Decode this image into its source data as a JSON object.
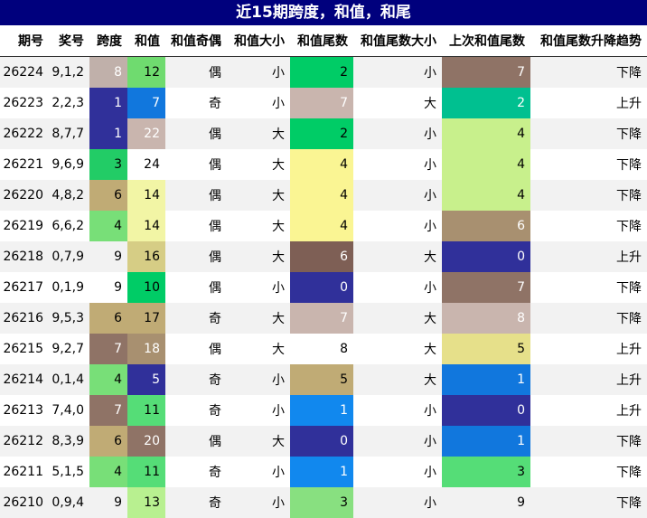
{
  "chart_data": {
    "type": "table",
    "title": "近15期跨度，和值，和尾",
    "columns": [
      "期号",
      "奖号",
      "跨度",
      "和值",
      "和值奇偶",
      "和值大小",
      "和值尾数",
      "和值尾数大小",
      "上次和值尾数",
      "和值尾数升降趋势"
    ],
    "rows": [
      [
        "26224",
        "9,1,2",
        "8",
        "12",
        "偶",
        "小",
        "2",
        "小",
        "7",
        "下降"
      ],
      [
        "26223",
        "2,2,3",
        "1",
        "7",
        "奇",
        "小",
        "7",
        "大",
        "2",
        "上升"
      ],
      [
        "26222",
        "8,7,7",
        "1",
        "22",
        "偶",
        "大",
        "2",
        "小",
        "4",
        "下降"
      ],
      [
        "26221",
        "9,6,9",
        "3",
        "24",
        "偶",
        "大",
        "4",
        "小",
        "4",
        "下降"
      ],
      [
        "26220",
        "4,8,2",
        "6",
        "14",
        "偶",
        "大",
        "4",
        "小",
        "4",
        "下降"
      ],
      [
        "26219",
        "6,6,2",
        "4",
        "14",
        "偶",
        "大",
        "4",
        "小",
        "6",
        "下降"
      ],
      [
        "26218",
        "0,7,9",
        "9",
        "16",
        "偶",
        "大",
        "6",
        "大",
        "0",
        "上升"
      ],
      [
        "26217",
        "0,1,9",
        "9",
        "10",
        "偶",
        "小",
        "0",
        "小",
        "7",
        "下降"
      ],
      [
        "26216",
        "9,5,3",
        "6",
        "17",
        "奇",
        "大",
        "7",
        "大",
        "8",
        "下降"
      ],
      [
        "26215",
        "9,2,7",
        "7",
        "18",
        "偶",
        "大",
        "8",
        "大",
        "5",
        "上升"
      ],
      [
        "26214",
        "0,1,4",
        "4",
        "5",
        "奇",
        "小",
        "5",
        "大",
        "1",
        "上升"
      ],
      [
        "26213",
        "7,4,0",
        "7",
        "11",
        "奇",
        "小",
        "1",
        "小",
        "0",
        "上升"
      ],
      [
        "26212",
        "8,3,9",
        "6",
        "20",
        "偶",
        "大",
        "0",
        "小",
        "1",
        "下降"
      ],
      [
        "26211",
        "5,1,5",
        "4",
        "11",
        "奇",
        "小",
        "1",
        "小",
        "3",
        "下降"
      ],
      [
        "26210",
        "0,9,4",
        "9",
        "13",
        "奇",
        "小",
        "3",
        "小",
        "9",
        "下降"
      ]
    ],
    "cell_colors": [
      [
        null,
        null,
        "#c0b0aa",
        "#6fdb6f",
        null,
        null,
        "#00cc66",
        null,
        "#8f7366",
        null
      ],
      [
        null,
        null,
        "#30309a",
        "#1177dd",
        null,
        null,
        "#c9b5ae",
        null,
        "#00c090",
        null
      ],
      [
        null,
        null,
        "#30309a",
        "#c9b5ae",
        null,
        null,
        "#00cc66",
        null,
        "#c8f08c",
        null
      ],
      [
        null,
        null,
        "#22cc66",
        null,
        null,
        null,
        "#faf593",
        null,
        "#c8f08c",
        null
      ],
      [
        null,
        null,
        "#c0ab75",
        "#f2f5a5",
        null,
        null,
        "#faf593",
        null,
        "#c8f08c",
        null
      ],
      [
        null,
        null,
        "#78df78",
        "#f2f5a5",
        null,
        null,
        "#faf593",
        null,
        "#a89070",
        null
      ],
      [
        null,
        null,
        null,
        "#d6cd85",
        null,
        null,
        "#7e5f55",
        null,
        "#30309a",
        null
      ],
      [
        null,
        null,
        null,
        "#00cc66",
        null,
        null,
        "#30309a",
        null,
        "#8f7366",
        null
      ],
      [
        null,
        null,
        "#c0ab75",
        "#c0ab75",
        null,
        null,
        "#c9b5ae",
        null,
        "#c9b5ae",
        null
      ],
      [
        null,
        null,
        "#8f7366",
        "#a89070",
        null,
        null,
        null,
        null,
        "#e6e08a",
        null
      ],
      [
        null,
        null,
        "#78df78",
        "#30309a",
        null,
        null,
        "#c0ab75",
        null,
        "#1177dd",
        null
      ],
      [
        null,
        null,
        "#8f7366",
        "#55dd77",
        null,
        null,
        "#1188ee",
        null,
        "#30309a",
        null
      ],
      [
        null,
        null,
        "#c0ab75",
        "#8f7366",
        null,
        null,
        "#30309a",
        null,
        "#1177dd",
        null
      ],
      [
        null,
        null,
        "#78df78",
        "#55dd77",
        null,
        null,
        "#1188ee",
        null,
        "#55dd77",
        null
      ],
      [
        null,
        null,
        null,
        "#b8f090",
        null,
        null,
        "#88e080",
        null,
        null,
        null
      ]
    ],
    "text_colors_light_on": [
      "#30309a",
      "#1177dd",
      "#1188ee",
      "#7e5f55",
      "#8f7366",
      "#a89070",
      "#c0b0aa",
      "#c9b5ae",
      "#00c090"
    ]
  }
}
